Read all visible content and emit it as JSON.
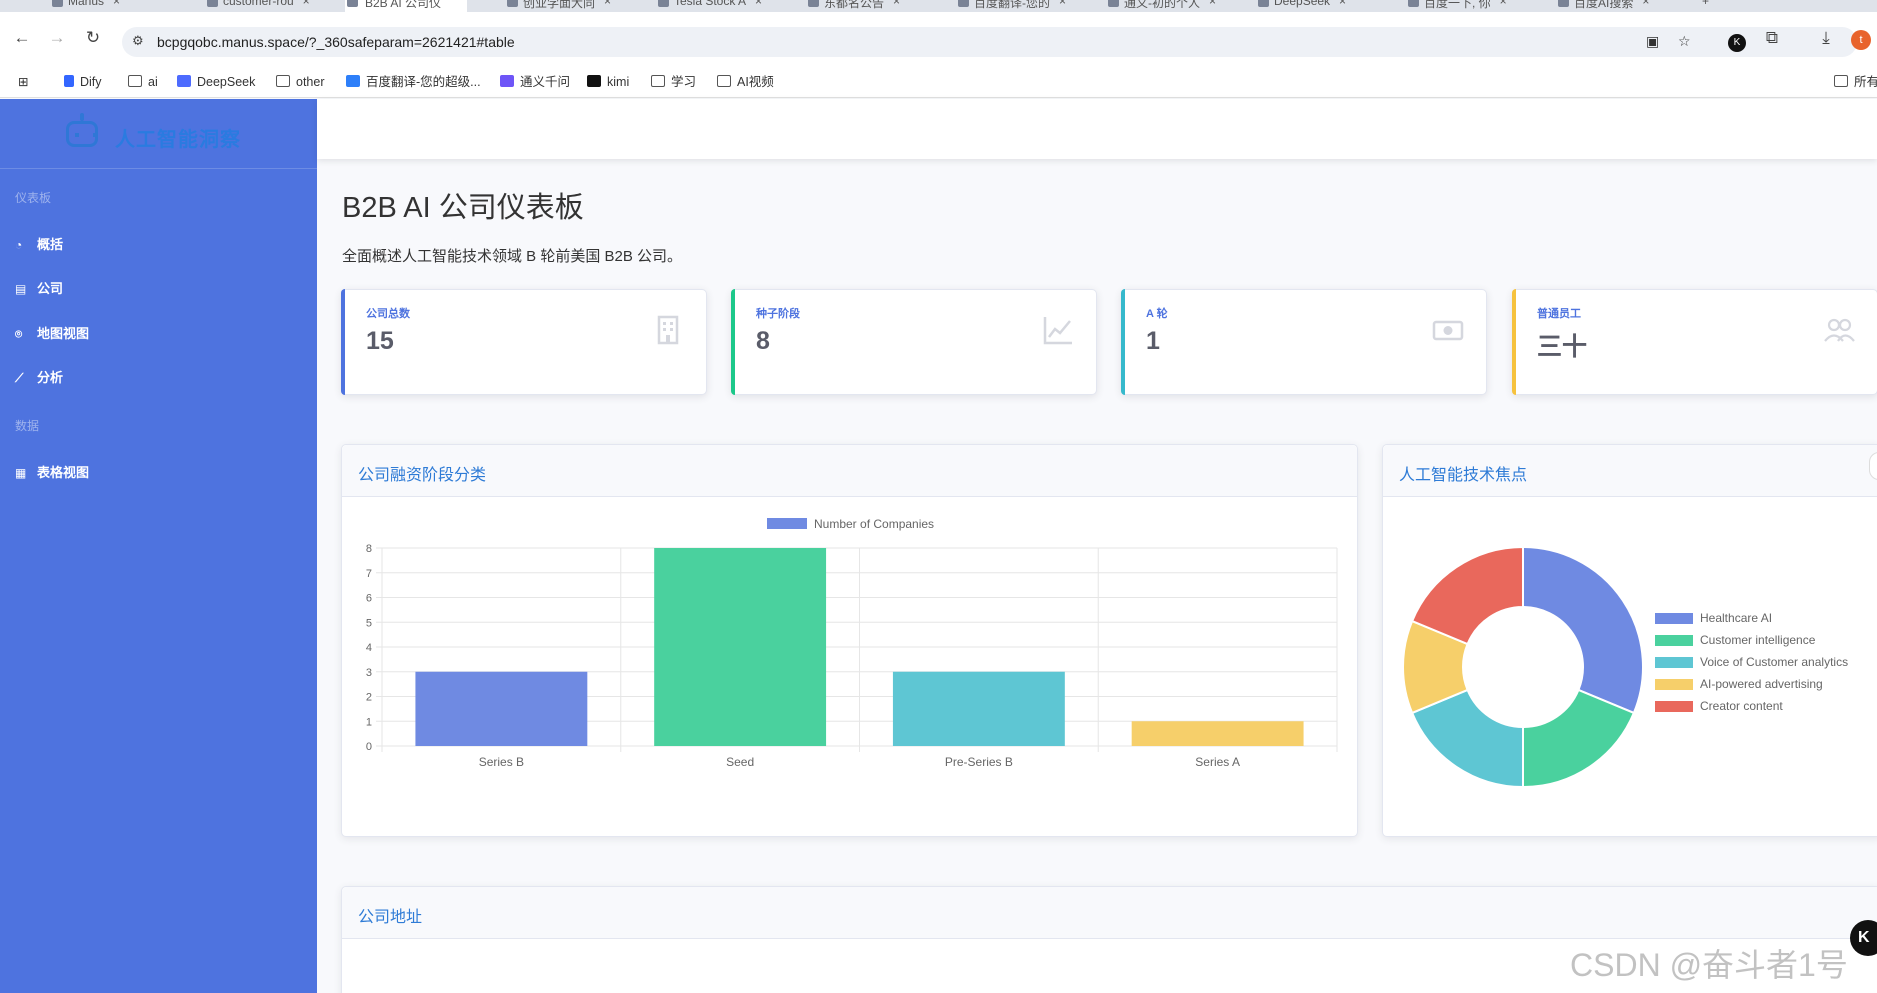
{
  "browser": {
    "tabs": [
      {
        "label": "Manus",
        "active": false
      },
      {
        "label": "customer-rou",
        "active": false
      },
      {
        "label": "B2B AI 公司仪",
        "active": true
      },
      {
        "label": "创业学面大同",
        "active": false
      },
      {
        "label": "Tesla Stock A",
        "active": false
      },
      {
        "label": "东都名公告",
        "active": false
      },
      {
        "label": "百度翻译-您的",
        "active": false
      },
      {
        "label": "通义-初的个人",
        "active": false
      },
      {
        "label": "DeepSeek",
        "active": false
      },
      {
        "label": "百度一下, 你",
        "active": false
      },
      {
        "label": "百度AI搜索",
        "active": false
      }
    ],
    "url": "bcpgqobc.manus.space/?_360safeparam=2621421#table",
    "profile_initial": "t",
    "bookmarks": [
      {
        "label": "Dify",
        "icon": "dify-icon"
      },
      {
        "label": "ai",
        "icon": "folder-icon"
      },
      {
        "label": "DeepSeek",
        "icon": "deepseek-icon"
      },
      {
        "label": "other",
        "icon": "folder-icon"
      },
      {
        "label": "百度翻译-您的超级...",
        "icon": "baidu-translate-icon"
      },
      {
        "label": "通义千问",
        "icon": "tongyi-icon"
      },
      {
        "label": "kimi",
        "icon": "kimi-icon"
      },
      {
        "label": "学习",
        "icon": "folder-icon"
      },
      {
        "label": "AI视频",
        "icon": "folder-icon"
      },
      {
        "label": "所有",
        "icon": "folder-icon"
      }
    ]
  },
  "sidebar": {
    "brand": "人工智能洞察",
    "sections": [
      {
        "heading": "仪表板",
        "items": [
          {
            "label": "概括",
            "icon": "tachometer-icon"
          },
          {
            "label": "公司",
            "icon": "building-icon"
          },
          {
            "label": "地图视图",
            "icon": "map-marker-icon"
          },
          {
            "label": "分析",
            "icon": "line-chart-icon"
          }
        ]
      },
      {
        "heading": "数据",
        "items": [
          {
            "label": "表格视图",
            "icon": "table-icon"
          }
        ]
      }
    ]
  },
  "page": {
    "title": "B2B AI 公司仪表板",
    "subtitle": "全面概述人工智能技术领域 B 轮前美国 B2B 公司。"
  },
  "stats": [
    {
      "label": "公司总数",
      "value": "15",
      "color": "#4e73df",
      "icon": "building-icon"
    },
    {
      "label": "种子阶段",
      "value": "8",
      "color": "#1cc88a",
      "icon": "chart-line-icon"
    },
    {
      "label": "A 轮",
      "value": "1",
      "color": "#36b9cc",
      "icon": "money-bill-icon"
    },
    {
      "label": "普通员工",
      "value": "三十",
      "color": "#f6c23e",
      "icon": "users-icon"
    }
  ],
  "panels": {
    "funding_title": "公司融资阶段分类",
    "tech_title": "人工智能技术焦点",
    "address_title": "公司地址"
  },
  "chart_data": [
    {
      "type": "bar",
      "categories": [
        "Series B",
        "Seed",
        "Pre-Series B",
        "Series A"
      ],
      "series": [
        {
          "name": "Number of Companies",
          "values": [
            3,
            8,
            3,
            1
          ]
        }
      ],
      "colors": [
        "#6f8ae2",
        "#4ad19e",
        "#5ec6d3",
        "#f6cf6a"
      ],
      "ylim": [
        0,
        8
      ],
      "yticks": [
        0,
        1,
        2,
        3,
        4,
        5,
        6,
        7,
        8
      ],
      "legend": "top",
      "grid": true
    },
    {
      "type": "pie",
      "donut": true,
      "labels": [
        "Healthcare AI",
        "Customer intelligence",
        "Voice of Customer analytics",
        "AI-powered advertising",
        "Creator content"
      ],
      "values": [
        5,
        3,
        3,
        2,
        3
      ],
      "colors": [
        "#6f8ae2",
        "#4ad19e",
        "#5ec6d3",
        "#f6cf6a",
        "#e9685c"
      ],
      "legend": "right"
    }
  ],
  "watermark": "CSDN @奋斗者1号",
  "float_button": "K"
}
